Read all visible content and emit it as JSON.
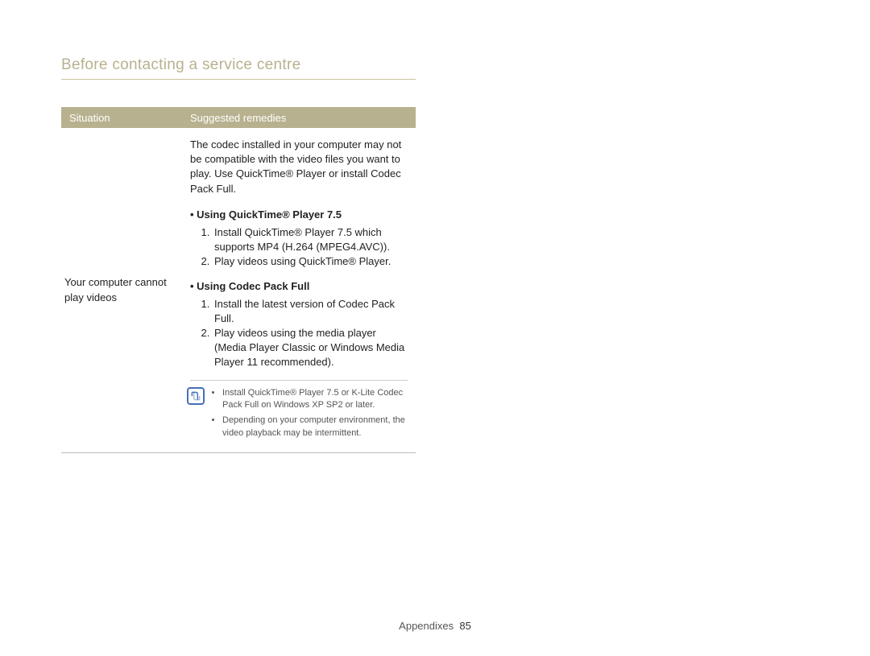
{
  "page_title": "Before contacting a service centre",
  "table": {
    "headers": {
      "situation": "Situation",
      "remedies": "Suggested remedies"
    },
    "row": {
      "situation": "Your computer cannot play videos",
      "intro": "The codec installed in your computer may not be compatible with the video files you want to play. Use QuickTime® Player or install Codec Pack Full.",
      "section1": {
        "heading": "• Using QuickTime® Player 7.5",
        "item1": "Install QuickTime® Player 7.5 which supports MP4 (H.264 (MPEG4.AVC)).",
        "item2": "Play videos using QuickTime® Player."
      },
      "section2": {
        "heading": "• Using Codec Pack Full",
        "item1": "Install the latest version of Codec Pack Full.",
        "item2": "Play videos using the media player (Media Player Classic or Windows Media Player 11 recommended)."
      },
      "note": {
        "item1": "Install QuickTime® Player 7.5 or K-Lite Codec Pack Full on Windows XP SP2 or later.",
        "item2": "Depending on your computer environment, the video playback may be intermittent."
      }
    }
  },
  "footer": {
    "section": "Appendixes",
    "page": "85"
  }
}
